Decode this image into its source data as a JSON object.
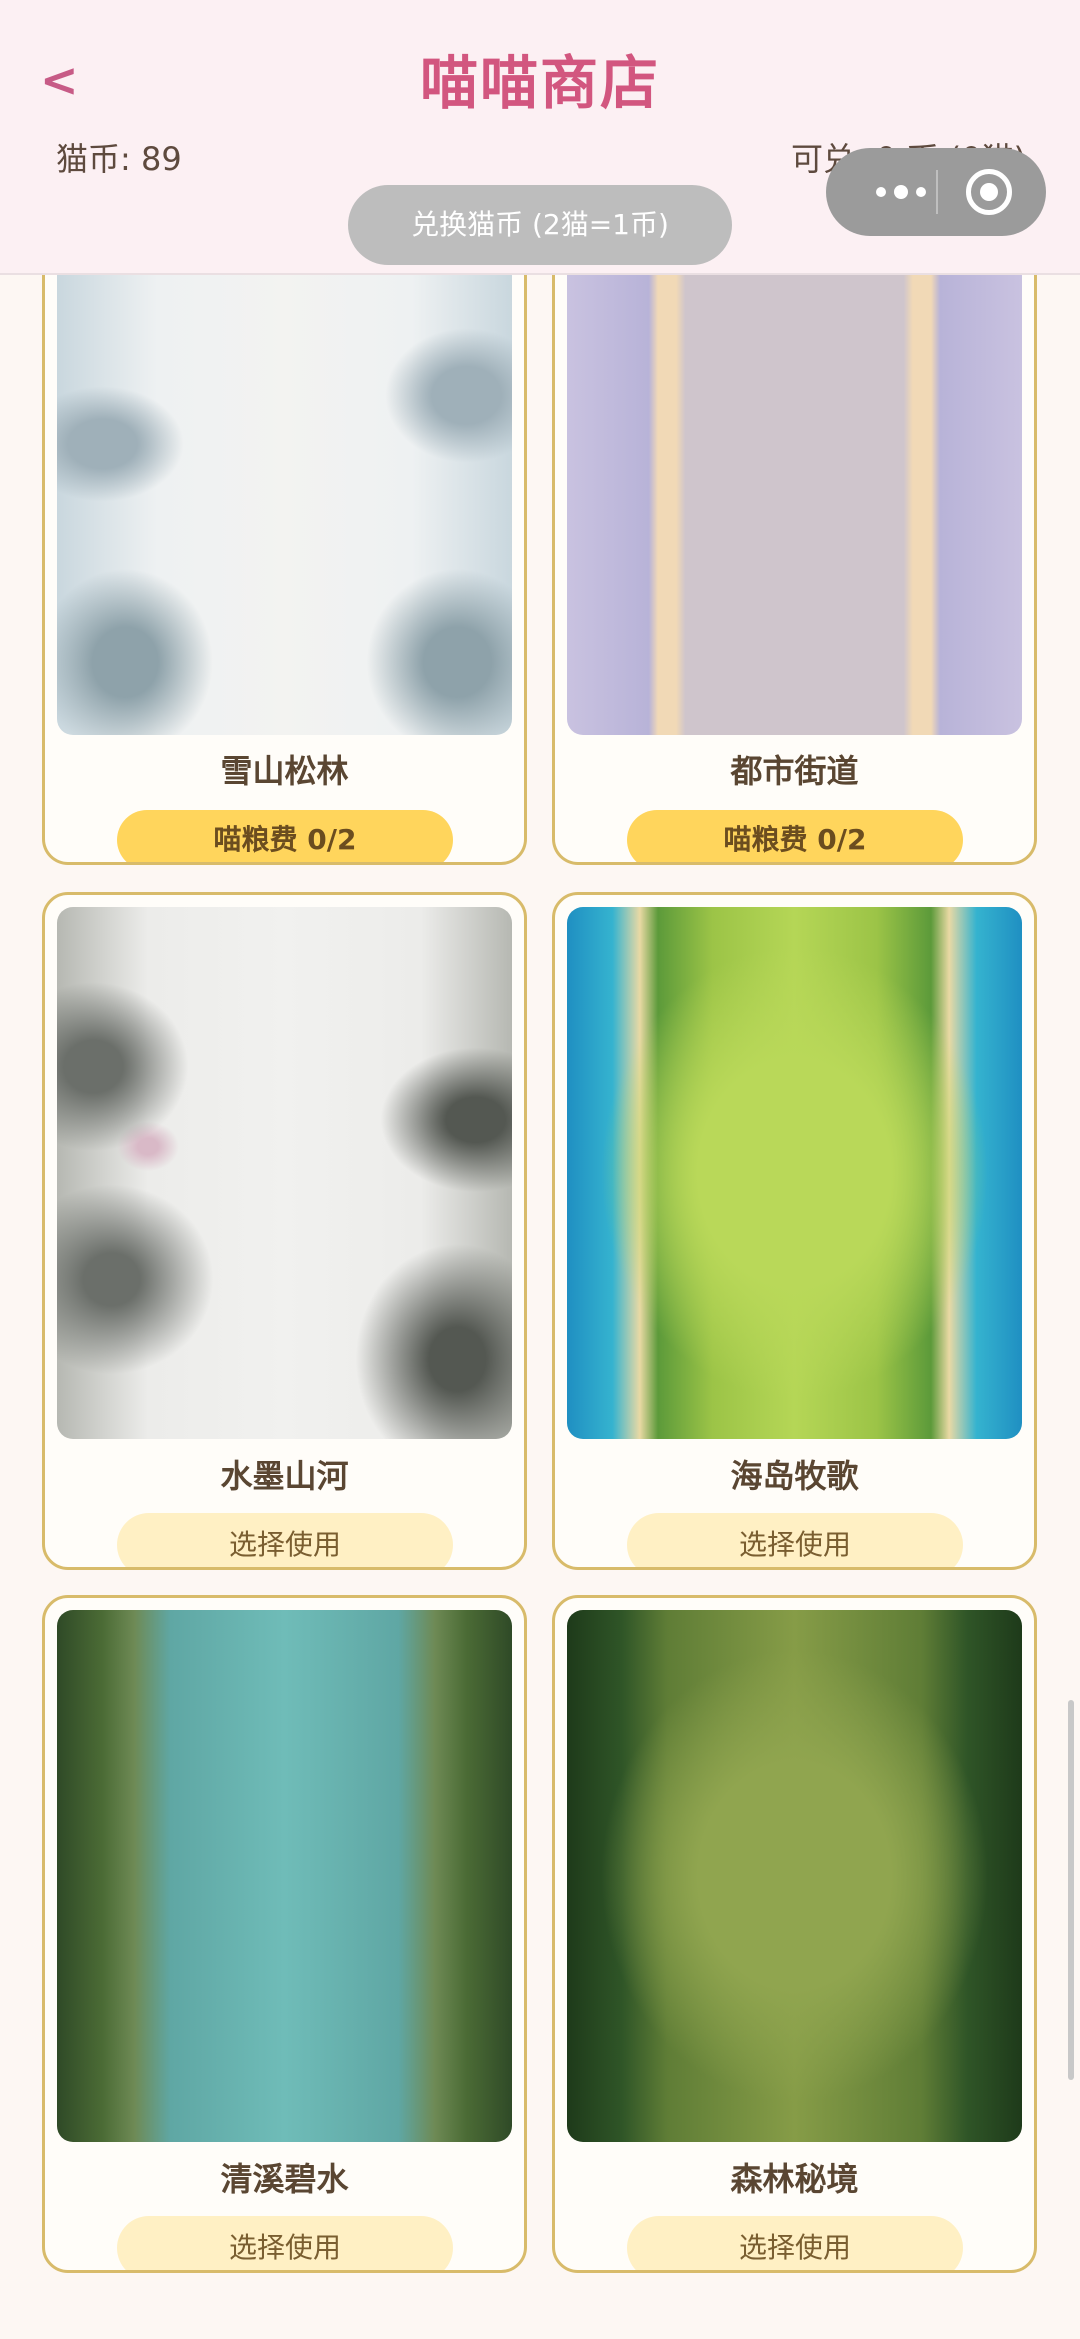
{
  "header": {
    "back_symbol": "<",
    "title": "喵喵商店",
    "coins_text": "猫币: 89",
    "exchangeable_text": "可兑: 0 币 (0猫)",
    "exchange_button": "兑换猫币 (2猫=1币)"
  },
  "capsule": {
    "more_icon": "more-dots-icon",
    "close_icon": "target-circle-icon"
  },
  "cards": [
    {
      "name": "雪山松林",
      "button": "喵粮费 0/2",
      "button_type": "buy"
    },
    {
      "name": "都市街道",
      "button": "喵粮费 0/2",
      "button_type": "buy"
    },
    {
      "name": "水墨山河",
      "button": "选择使用",
      "button_type": "use"
    },
    {
      "name": "海岛牧歌",
      "button": "选择使用",
      "button_type": "use"
    },
    {
      "name": "清溪碧水",
      "button": "选择使用",
      "button_type": "use"
    },
    {
      "name": "森林秘境",
      "button": "选择使用",
      "button_type": "use"
    }
  ],
  "colors": {
    "title": "#d2567f",
    "buy_button": "#ffd55c",
    "use_button": "#fff0c4",
    "card_border": "#d8bb6a"
  }
}
